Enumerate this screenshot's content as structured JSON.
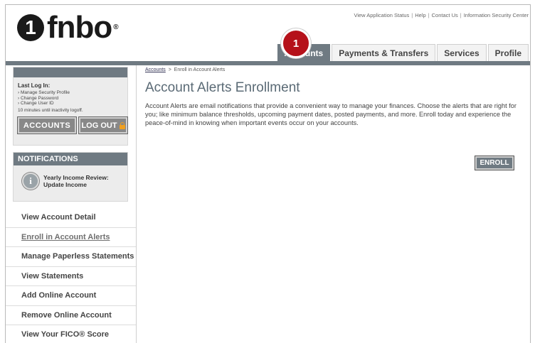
{
  "logo": {
    "mark": "1",
    "text": "fnbo",
    "reg": "®"
  },
  "top_links": [
    "View Application Status",
    "Help",
    "Contact Us",
    "Information Security Center"
  ],
  "tabs": [
    {
      "label": "Accounts",
      "active": true
    },
    {
      "label": "Payments & Transfers"
    },
    {
      "label": "Services"
    },
    {
      "label": "Profile"
    }
  ],
  "step_badge": "1",
  "login": {
    "title": "Last Log In:",
    "links": [
      "Manage Security Profile",
      "Change Password",
      "Change User ID"
    ],
    "note": "10 minutes until inactivity logoff.",
    "accounts_button": "ACCOUNTS",
    "logout_button": "LOG OUT"
  },
  "notifications": {
    "heading": "NOTIFICATIONS",
    "item_line1": "Yearly Income Review:",
    "item_line2": "Update Income"
  },
  "nav": [
    {
      "label": "View Account Detail"
    },
    {
      "label": "Enroll in Account Alerts",
      "active": true
    },
    {
      "label": "Manage Paperless Statements"
    },
    {
      "label": "View Statements"
    },
    {
      "label": "Add Online Account"
    },
    {
      "label": "Remove Online Account"
    },
    {
      "label": "View Your FICO® Score"
    }
  ],
  "breadcrumb": {
    "link": "Accounts",
    "separator": ">",
    "current": "Enroll in Account Alerts"
  },
  "page_title": "Account Alerts Enrollment",
  "description": "Account Alerts are email notifications that provide a convenient way to manage your finances. Choose the alerts that are right for you; like minimum balance thresholds, upcoming payment dates, posted payments, and more. Enroll today and experience the peace-of-mind in knowing when important events occur on your accounts.",
  "enroll_button": "ENROLL",
  "colors": {
    "accent": "#6f7a82",
    "badge": "#b5111a"
  }
}
